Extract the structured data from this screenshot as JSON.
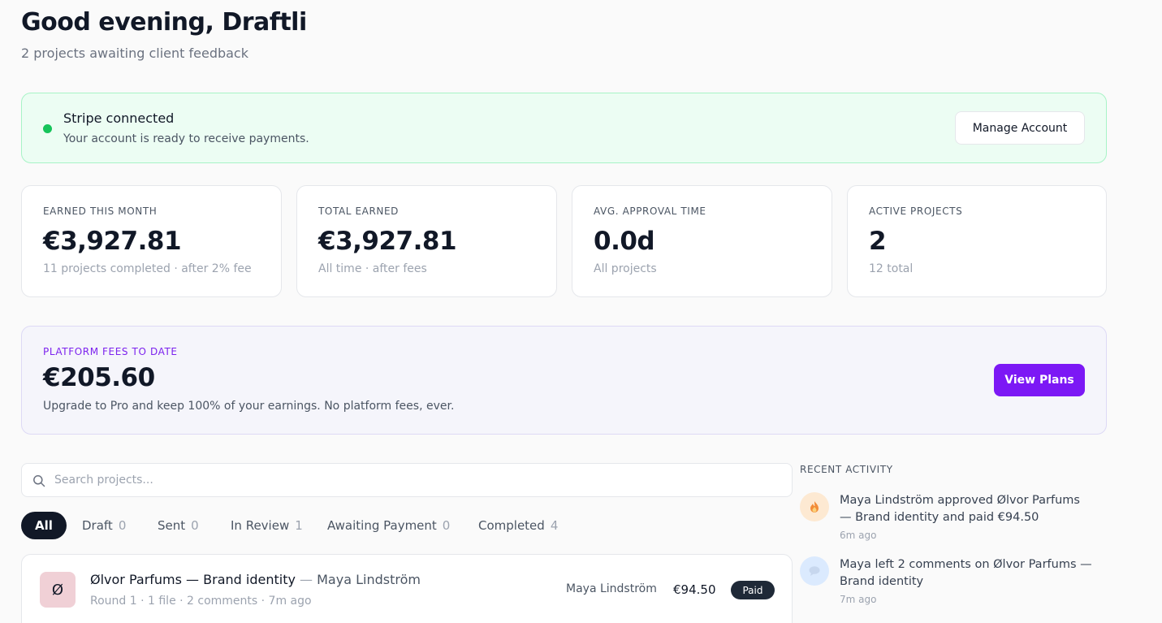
{
  "header": {
    "greeting": "Good evening, Draftli",
    "subtitle": "2 projects awaiting client feedback"
  },
  "stripe": {
    "title": "Stripe connected",
    "description": "Your account is ready to receive payments.",
    "button_label": "Manage Account",
    "status_color": "#16c45a"
  },
  "stats": [
    {
      "label": "EARNED THIS MONTH",
      "value": "€3,927.81",
      "note": "11 projects completed · after 2% fee"
    },
    {
      "label": "TOTAL EARNED",
      "value": "€3,927.81",
      "note": "All time · after fees"
    },
    {
      "label": "AVG. APPROVAL TIME",
      "value": "0.0d",
      "note": "All projects"
    },
    {
      "label": "ACTIVE PROJECTS",
      "value": "2",
      "note": "12 total"
    }
  ],
  "fees": {
    "label": "PLATFORM FEES TO DATE",
    "value": "€205.60",
    "description": "Upgrade to Pro and keep 100% of your earnings. No platform fees, ever.",
    "button_label": "View Plans",
    "accent_color": "#7c18f5"
  },
  "search": {
    "placeholder": "Search projects...",
    "value": "",
    "icon": "search-icon"
  },
  "filters": [
    {
      "label": "All",
      "count": "",
      "active": true
    },
    {
      "label": "Draft",
      "count": "0"
    },
    {
      "label": "Sent",
      "count": "0"
    },
    {
      "label": "In Review",
      "count": "1"
    },
    {
      "label": "Awaiting Payment",
      "count": "0"
    },
    {
      "label": "Completed",
      "count": "4"
    }
  ],
  "projects": [
    {
      "initial": "Ø",
      "name": "Ølvor Parfums — Brand identity",
      "separator": "—",
      "client_inline": "Maya Lindström",
      "meta": "Round 1 · 1 file · 2 comments · 7m ago",
      "client": "Maya Lindström",
      "price": "€94.50",
      "status": "Paid"
    }
  ],
  "activity": {
    "heading": "RECENT ACTIVITY",
    "items": [
      {
        "icon": "flame-icon",
        "text": "Maya Lindström approved Ølvor Parfums — Brand identity and paid €94.50",
        "time": "6m ago"
      },
      {
        "icon": "comment-icon",
        "text": "Maya left 2 comments on Ølvor Parfums — Brand identity",
        "time": "7m ago"
      }
    ]
  }
}
